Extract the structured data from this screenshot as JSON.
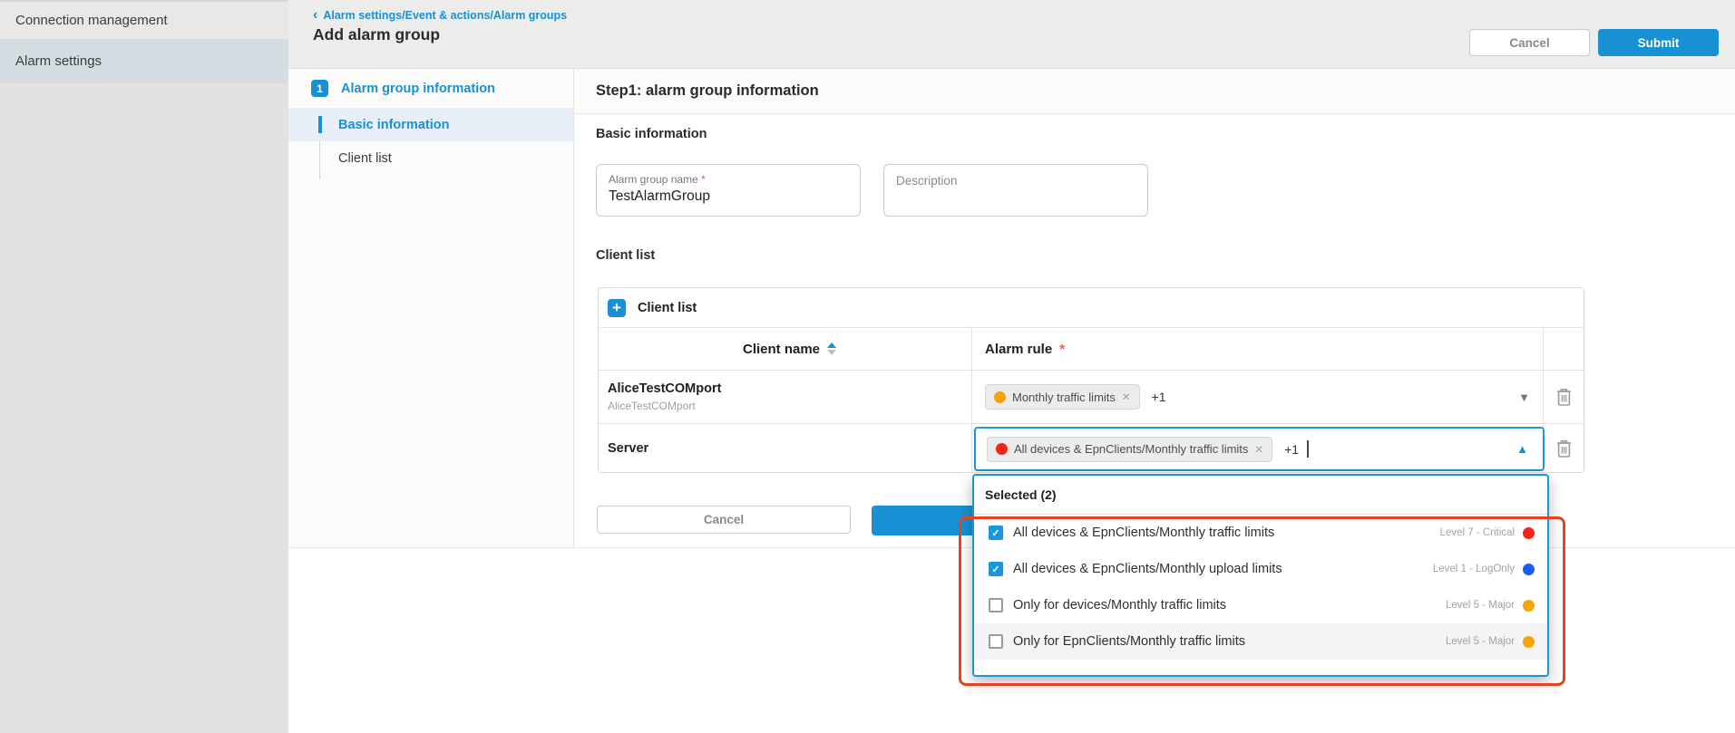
{
  "colors": {
    "accent_blue": "#1791d4",
    "checkbox_blue": "#1a96dd",
    "focus_border_blue": "#1e95d6",
    "annotation_red": "#e8431f",
    "severity_critical": "#f1251b",
    "severity_logonly": "#1a5df2",
    "severity_major": "#f5a40a",
    "sidebar_selected_bg": "#d3dde2"
  },
  "icons": {
    "back": "‹",
    "plus": "+",
    "check": "✓",
    "close": "✕",
    "caret_down": "▼",
    "caret_up": "▲"
  },
  "sidebar": {
    "items": [
      {
        "label": "Connection management",
        "selected": false
      },
      {
        "label": "Alarm settings",
        "selected": true
      }
    ]
  },
  "header": {
    "breadcrumb": "Alarm settings/Event & actions/Alarm groups",
    "title": "Add alarm group",
    "cancel_label": "Cancel",
    "submit_label": "Submit"
  },
  "stepnav": {
    "step_number": "1",
    "step_label": "Alarm group information",
    "items": [
      {
        "label": "Basic information",
        "active": true
      },
      {
        "label": "Client list",
        "active": false
      }
    ]
  },
  "main": {
    "step_title": "Step1: alarm group information",
    "basic_info": {
      "section_label": "Basic information",
      "name_field": {
        "label": "Alarm group name",
        "required_mark": "*",
        "value": "TestAlarmGroup"
      },
      "description_field": {
        "placeholder": "Description",
        "value": ""
      }
    },
    "client_list": {
      "section_label": "Client list",
      "add_button_label": "Client list",
      "columns": {
        "client_name": "Client name",
        "alarm_rule": "Alarm rule",
        "required_mark": "*"
      },
      "rows": [
        {
          "client_name": "AliceTestCOMport",
          "client_subtitle": "AliceTestCOMport",
          "tag": {
            "label": "Monthly traffic limits",
            "severity_color": "#f5a40a"
          },
          "more_count": "+1",
          "state": "collapsed"
        },
        {
          "client_name": "Server",
          "client_subtitle": "",
          "tag": {
            "label": "All devices & EpnClients/Monthly traffic limits",
            "severity_color": "#f1251b"
          },
          "more_count": "+1",
          "state": "expanded"
        }
      ]
    },
    "footer": {
      "cancel_label": "Cancel"
    }
  },
  "dropdown": {
    "header": "Selected (2)",
    "options": [
      {
        "label": "All devices & EpnClients/Monthly traffic limits",
        "level": "Level 7 - Critical",
        "color": "#f1251b",
        "checked": true
      },
      {
        "label": "All devices & EpnClients/Monthly upload limits",
        "level": "Level 1 - LogOnly",
        "color": "#1a5df2",
        "checked": true
      },
      {
        "label": "Only for devices/Monthly traffic limits",
        "level": "Level 5 - Major",
        "color": "#f5a40a",
        "checked": false
      },
      {
        "label": "Only for EpnClients/Monthly traffic limits",
        "level": "Level 5 - Major",
        "color": "#f5a40a",
        "checked": false
      }
    ]
  }
}
